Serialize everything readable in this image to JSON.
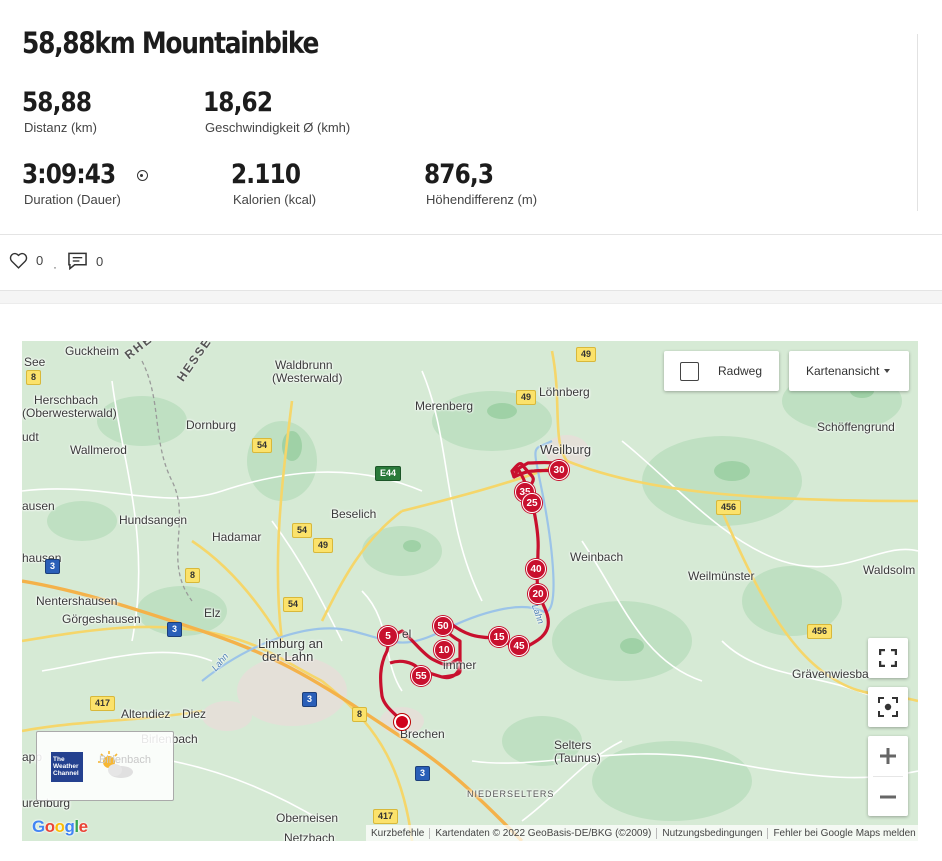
{
  "activity": {
    "title": "58,88km Mountainbike",
    "stats": [
      {
        "value": "58,88",
        "label": "Distanz (km)"
      },
      {
        "value": "18,62",
        "label": "Geschwindigkeit Ø (kmh)"
      },
      {
        "value": "3:09:43",
        "label": "Duration (Dauer)"
      },
      {
        "value": "2.110",
        "label": "Kalorien (kcal)"
      },
      {
        "value": "876,3",
        "label": "Höhendifferenz (m)"
      }
    ]
  },
  "social": {
    "likes": "0",
    "separator": "·",
    "comments": "0"
  },
  "map": {
    "radweg_label": "Radweg",
    "radweg_checked": false,
    "view_label": "Kartenansicht",
    "route_color": "#c8102e",
    "places": {
      "see": "See",
      "guckheim": "Guckheim",
      "herschbach": "Herschbach",
      "oberwesterwald": "(Oberwesterwald)",
      "udt": "udt",
      "wallmerod": "Wallmerod",
      "ausen": "ausen",
      "hausen": "hausen",
      "nentershausen": "Nentershausen",
      "goergeshausen": "Görgeshausen",
      "app": "app",
      "urenburg": "urenburg",
      "waldbrunn": "Waldbrunn",
      "westerwald": "(Westerwald)",
      "dornburg": "Dornburg",
      "hundsangen": "Hundsangen",
      "hadamar": "Hadamar",
      "beselich": "Beselich",
      "elz": "Elz",
      "limburg": "Limburg an",
      "lahn": "der Lahn",
      "altendiez": "Altendiez",
      "diez": "Diez",
      "birlenbach": "Birlenbach",
      "merenberg": "Merenberg",
      "loehnberg": "Löhnberg",
      "weilburg": "Weilburg",
      "schoeffengrund": "Schöffengrund",
      "weinbach": "Weinbach",
      "weilmuenster": "Weilmünster",
      "waldsolm": "Waldsolm",
      "graevenwiesba": "Grävenwiesba",
      "brechen": "Brechen",
      "selters": "Selters",
      "taunus": "(Taunus)",
      "niederselters": "NIEDERSELTERS",
      "oberneisen": "Oberneisen",
      "netzbach": "Netzbach",
      "el": "el",
      "immer": "immer",
      "rheinland": "RHEINL",
      "hessen": "HESSEN",
      "lahn_river": "Lahn",
      "lahn_river2": "Lahn"
    },
    "shields": {
      "s8a": "8",
      "s8b": "8",
      "s8c": "8",
      "s49a": "49",
      "s49b": "49",
      "s49c": "49",
      "s54a": "54",
      "s54b": "54",
      "s54c": "54",
      "s3a": "3",
      "s3b": "3",
      "s3c": "3",
      "s3d": "3",
      "s417a": "417",
      "s417b": "417",
      "s456a": "456",
      "s456b": "456",
      "e44": "E44"
    },
    "markers": [
      "30",
      "35",
      "25",
      "40",
      "20",
      "50",
      "15",
      "10",
      "45",
      "5",
      "55"
    ],
    "weather_provider": "The Weather Channel",
    "weather_town": "Birlenbach",
    "google_logo": "Google",
    "attribution": {
      "shortcuts": "Kurzbefehle",
      "data": "Kartendaten © 2022 GeoBasis-DE/BKG (©2009)",
      "terms": "Nutzungsbedingungen",
      "report": "Fehler bei Google Maps melden"
    }
  }
}
